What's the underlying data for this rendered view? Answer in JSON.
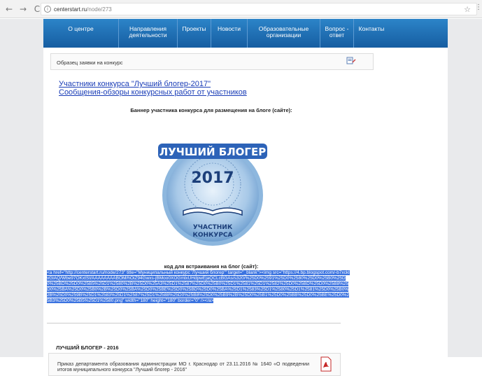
{
  "browser": {
    "back_glyph": "←",
    "forward_glyph": "→",
    "reload_glyph": "C",
    "url_host": "centerstart.ru",
    "url_path": "/node/273",
    "star_glyph": "☆",
    "menu_glyph": "⋮"
  },
  "nav": {
    "items": [
      {
        "label": "О центре",
        "icon": "none"
      },
      {
        "label": "Направления деятельности"
      },
      {
        "label": "Проекты"
      },
      {
        "label": "Новости"
      },
      {
        "label": "Образовательные организации"
      },
      {
        "label": "Вопрос - ответ"
      },
      {
        "label": "Контакты"
      }
    ],
    "bg_color": "#1f72b8"
  },
  "sample_box": {
    "text": "Образец заявки на конкурс",
    "icon": "edit-document-icon"
  },
  "links": {
    "participants": "Участники конкурса \"Лучший блогер-2017\"",
    "reviews": "Сообщения-обзоры конкурсных работ от участников"
  },
  "banner": {
    "heading": "Баннер участника конкурса для размещения на блоге (сайте):",
    "title": "ЛУЧШИЙ БЛОГЕР",
    "year": "2017",
    "caption_line1": "УЧАСТНИК",
    "caption_line2": "КОНКУРСА"
  },
  "embed": {
    "heading": "код для встраивания на блог (сайт):",
    "code": "<a href=\"http://centerstart.ru/node/273\" title=\"Муниципальный конкурс 'Лучший блогер'\" target=\"_blank\"><img src=\"https://4.bp.blogspot.com/-b7xcklvGlAQ/Wbe97OKxtSI/AAAAAAAABOM/hOiZ94Gwxs-jBMoo0XOGmlxUHdpwEjaQCLcBGAs/s320/%25D0%2591%25D0%2580%25D0%25B0%25D0%25BD%25D0%25B5%25D1%2580%2B%25D0%25A3%25D1%2587%25D0%25B0%25D1%2581%25D1%2582%25D0%25BD%25D0%25B8%25D0%25BA%25D0%25B0%2B%25D0%25BA%25D0%25BE%25D0%25BD%25D0%25BA%25D1%2583%25D1%2580%25D1%2581%25D0%25B0%2B%25D0%259B%25D1%2583%25D1%2587%25D1%2588%25D0%25B8%25D0%25B9%2B%25D0%25B1%25D0%25BB%25D0%25BE%25D0%25B3%25D0%25B5%25D1%2580.png\" width=\"180\" height=\"180\" border=\"0\" /></a>"
  },
  "section": {
    "title": "ЛУЧШИЙ БЛОГЕР - 2016",
    "order_text": "Приказ департамента образования администрации МО г. Краснодар от 23.11.2016 № 1640 «О подведении итогов муниципального конкурса \"Лучший блогер - 2016\"",
    "icon": "pdf-icon"
  }
}
